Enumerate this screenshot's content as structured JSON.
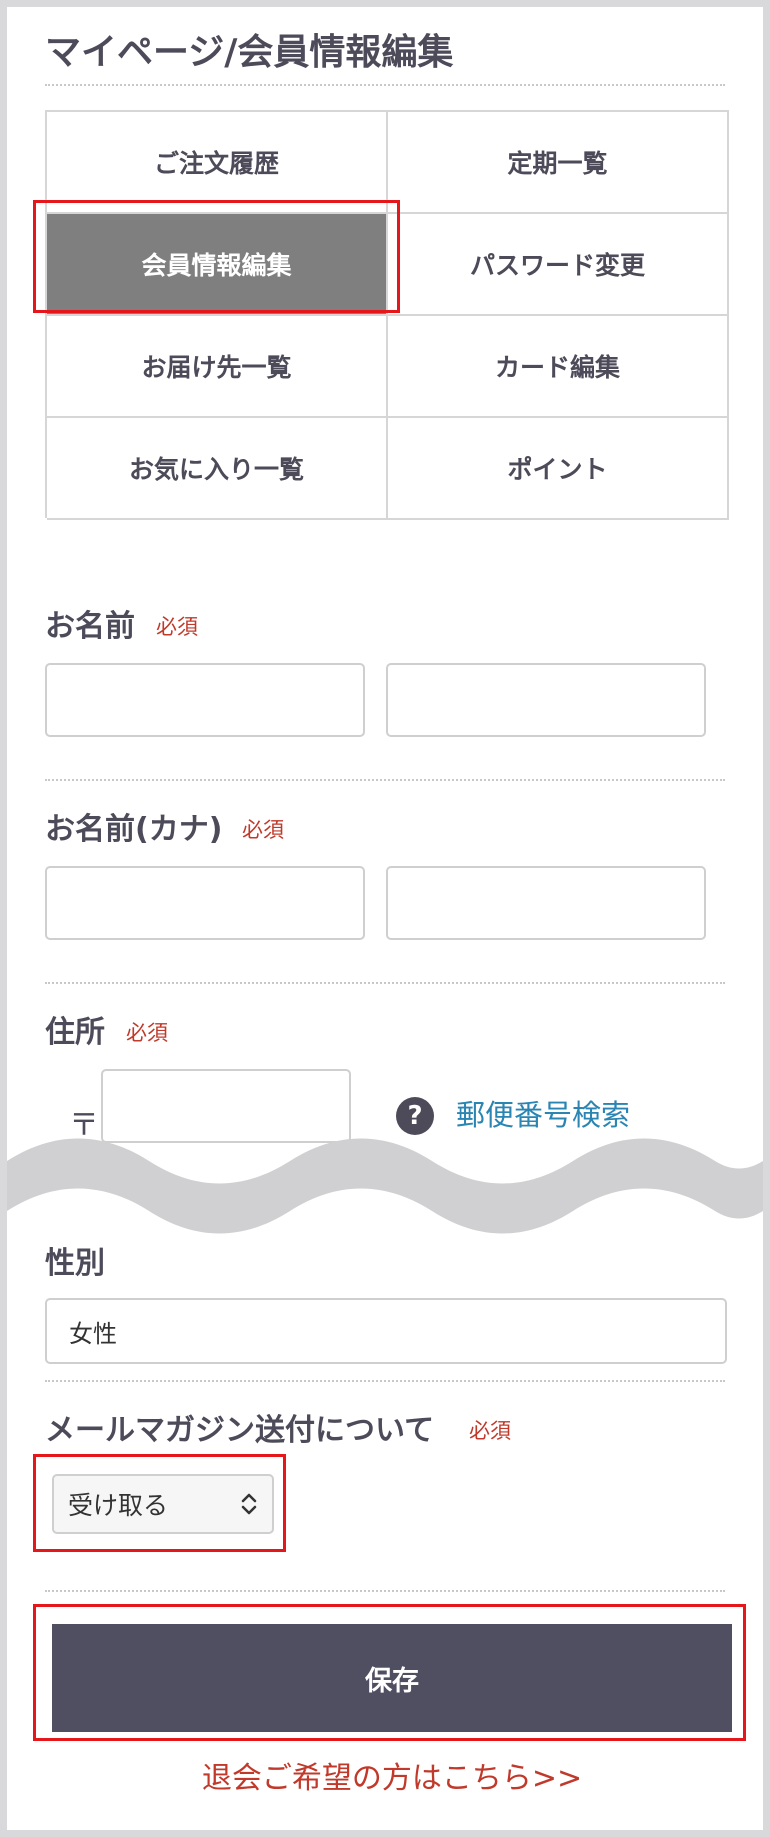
{
  "page_title": "マイページ/会員情報編集",
  "tabs": [
    {
      "label": "ご注文履歴",
      "active": false
    },
    {
      "label": "定期一覧",
      "active": false
    },
    {
      "label": "会員情報編集",
      "active": true
    },
    {
      "label": "パスワード変更",
      "active": false
    },
    {
      "label": "お届け先一覧",
      "active": false
    },
    {
      "label": "カード編集",
      "active": false
    },
    {
      "label": "お気に入り一覧",
      "active": false
    },
    {
      "label": "ポイント",
      "active": false
    }
  ],
  "required_label": "必須",
  "name": {
    "label": "お名前",
    "last_value": "",
    "first_value": ""
  },
  "name_kana": {
    "label": "お名前(カナ)",
    "last_value": "",
    "first_value": ""
  },
  "address": {
    "label": "住所",
    "postal_mark": "〒",
    "postal_value": "",
    "help_icon": "question-circle-icon",
    "zip_search_label": "郵便番号検索"
  },
  "gender": {
    "label": "性別",
    "value": "女性"
  },
  "magazine": {
    "label": "メールマガジン送付について",
    "selected": "受け取る",
    "icon": "chevron-up-down-icon"
  },
  "save_label": "保存",
  "withdraw_link": "退会ご希望の方はこちら>>",
  "colors": {
    "accent_dark": "#504e61",
    "active_tab": "#807f80",
    "required": "#c0392b",
    "link": "#2a85b3",
    "highlight": "#e5171b"
  }
}
